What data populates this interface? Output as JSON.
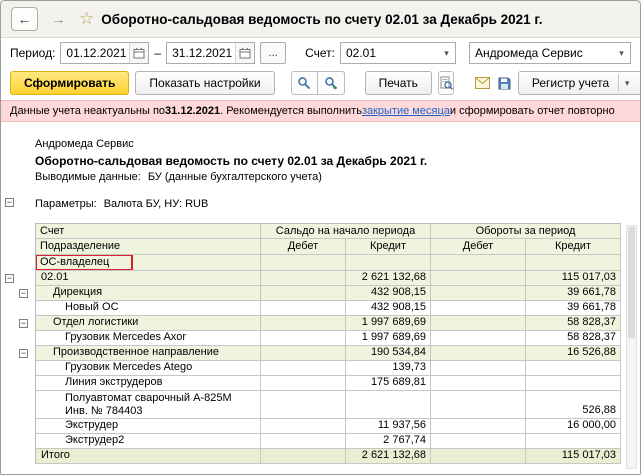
{
  "icons": {
    "back": "←",
    "forward": "→",
    "star": "☆",
    "dropdown": "▾",
    "more": "...",
    "collapse": "−"
  },
  "titlebar": {
    "title": "Оборотно-сальдовая ведомость по счету 02.01 за Декабрь 2021 г."
  },
  "filters": {
    "period_label": "Период:",
    "period_from": "01.12.2021",
    "period_separator": "–",
    "period_to": "31.12.2021",
    "account_label": "Счет:",
    "account_value": "02.01",
    "organization_value": "Андромеда Сервис"
  },
  "toolbar": {
    "generate": "Сформировать",
    "settings": "Показать настройки",
    "print": "Печать",
    "register": "Регистр учета"
  },
  "warning": {
    "prefix": "Данные учета неактуальны по ",
    "date": "31.12.2021",
    "middle": ". Рекомендуется выполнить ",
    "link": "закрытие месяца",
    "suffix": " и сформировать отчет повторно"
  },
  "report_header": {
    "company": "Андромеда Сервис",
    "title": "Оборотно-сальдовая ведомость по счету 02.01 за Декабрь 2021 г.",
    "data_label": "Выводимые данные:",
    "data_value": "БУ (данные бухгалтерского учета)",
    "params_label": "Параметры:",
    "params_value": "Валюта БУ, НУ: RUB"
  },
  "table": {
    "headers": {
      "account": "Счет",
      "division": "Подразделение",
      "os_owner": "ОС-владелец",
      "opening": "Сальдо на начало периода",
      "turnover": "Обороты за период",
      "debit": "Дебет",
      "credit": "Кредит"
    },
    "rows": [
      {
        "label": "02.01",
        "level": 0,
        "group": true,
        "exp": 0,
        "sd": "",
        "sk": "2 621 132,68",
        "od": "",
        "ok": "115 017,03"
      },
      {
        "label": "Дирекция",
        "level": 1,
        "group": true,
        "exp": 1,
        "sd": "",
        "sk": "432 908,15",
        "od": "",
        "ok": "39 661,78"
      },
      {
        "label": "Новый ОС",
        "level": 2,
        "sd": "",
        "sk": "432 908,15",
        "od": "",
        "ok": "39 661,78"
      },
      {
        "label": "Отдел логистики",
        "level": 1,
        "group": true,
        "exp": 1,
        "sd": "",
        "sk": "1 997 689,69",
        "od": "",
        "ok": "58 828,37"
      },
      {
        "label": "Грузовик Mercedes Axor",
        "level": 2,
        "sd": "",
        "sk": "1 997 689,69",
        "od": "",
        "ok": "58 828,37"
      },
      {
        "label": "Производственное направление",
        "level": 1,
        "group": true,
        "exp": 1,
        "sd": "",
        "sk": "190 534,84",
        "od": "",
        "ok": "16 526,88"
      },
      {
        "label": "Грузовик Mercedes Atego",
        "level": 2,
        "sd": "",
        "sk": "139,73",
        "od": "",
        "ok": ""
      },
      {
        "label": "Линия экструдеров",
        "level": 2,
        "sd": "",
        "sk": "175 689,81",
        "od": "",
        "ok": ""
      },
      {
        "label": "Полуавтомат сварочный А-825М",
        "label2": "Инв. № 784403",
        "level": 2,
        "sd": "",
        "sk": "",
        "od": "",
        "ok": "526,88"
      },
      {
        "label": "Экструдер",
        "level": 2,
        "sd": "",
        "sk": "11 937,56",
        "od": "",
        "ok": "16 000,00"
      },
      {
        "label": "Экструдер2",
        "level": 2,
        "sd": "",
        "sk": "2 767,74",
        "od": "",
        "ok": ""
      },
      {
        "label": "Итого",
        "level": 0,
        "total": true,
        "sd": "",
        "sk": "2 621 132,68",
        "od": "",
        "ok": "115 017,03"
      }
    ]
  }
}
